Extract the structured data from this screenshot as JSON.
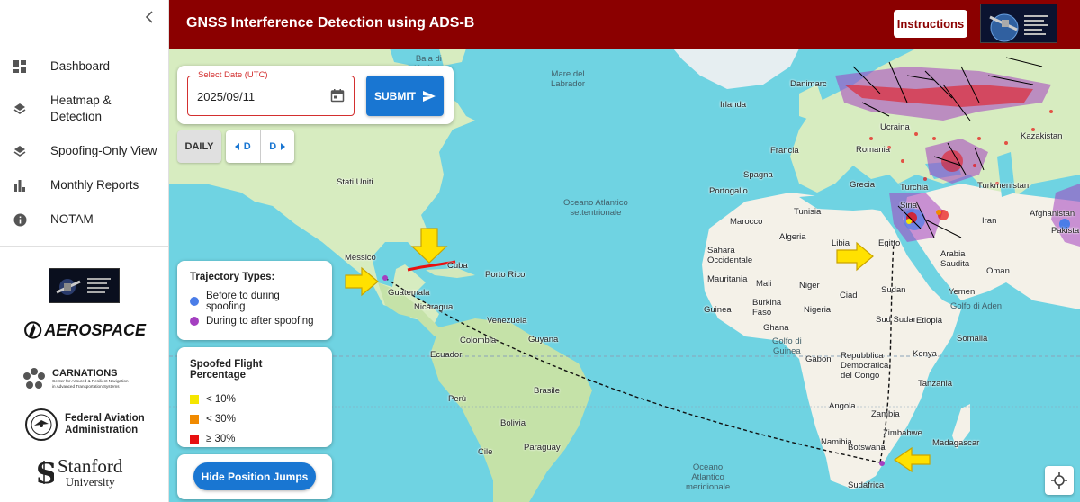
{
  "header": {
    "title": "GNSS Interference Detection using ADS-B",
    "instructions_label": "Instructions"
  },
  "sidebar": {
    "items": [
      {
        "label": "Dashboard",
        "icon": "dashboard-icon"
      },
      {
        "label": "Heatmap & Detection",
        "icon": "layers-icon"
      },
      {
        "label": "Spoofing-Only View",
        "icon": "layers-icon"
      },
      {
        "label": "Monthly Reports",
        "icon": "bar-chart-icon"
      },
      {
        "label": "NOTAM",
        "icon": "info-icon"
      }
    ],
    "logos": {
      "aerospace": "AEROSPACE",
      "carnations_title": "CARNATIONS",
      "carnations_sub1": "Center for Assured & Resilient Navigation",
      "carnations_sub2": "in Advanced Transportation Systems",
      "faa_line1": "Federal Aviation",
      "faa_line2": "Administration",
      "stanford_line1": "Stanford",
      "stanford_line2": "University"
    }
  },
  "date_picker": {
    "label": "Select Date (UTC)",
    "value": "2025/09/11",
    "submit_label": "SUBMIT"
  },
  "controls": {
    "daily_label": "DAILY",
    "prev_label": "D",
    "next_label": "D"
  },
  "trajectory_legend": {
    "title": "Trajectory Types:",
    "items": [
      {
        "label": "Before to during spoofing",
        "color": "#4a7de8"
      },
      {
        "label": "During to after spoofing",
        "color": "#a43fc0"
      }
    ]
  },
  "spoof_legend": {
    "title": "Spoofed Flight Percentage",
    "items": [
      {
        "label": "< 10%",
        "color": "#f5e600"
      },
      {
        "label": "< 30%",
        "color": "#f08a00"
      },
      {
        "label": "≥ 30%",
        "color": "#e81010"
      }
    ]
  },
  "hide_jumps_label": "Hide Position Jumps",
  "map": {
    "labels": {
      "baia": "Baia di\nHudson",
      "mare_labrador": "Mare del\nLabrador",
      "irlanda": "Irlanda",
      "danimarca": "Danimarc",
      "ucraina": "Ucraina",
      "kazakistan": "Kazakistan",
      "romania": "Romania",
      "francia": "Francia",
      "spagna": "Spagna",
      "portogallo": "Portogallo",
      "grecia": "Grecia",
      "turchia": "Turchia",
      "turkmenistan": "Turkmenistan",
      "afghanistan": "Afghanistan",
      "stati_uniti": "Stati Uniti",
      "oceano_atl_sett": "Oceano Atlantico\nsettentrionale",
      "siria": "Siria",
      "iran": "Iran",
      "tunisia": "Tunisia",
      "marocco": "Marocco",
      "pakistan": "Pakista",
      "algeria": "Algeria",
      "libia": "Libia",
      "egitto": "Egitto",
      "messico": "Messico",
      "cuba": "Cuba",
      "portorico": "Porto Rico",
      "sahara_occ": "Sahara\nOccidentale",
      "arabia": "Arabia\nSaudita",
      "oman": "Oman",
      "guatemala": "Guatemala",
      "mauritania": "Mauritania",
      "mali": "Mali",
      "niger": "Niger",
      "ciad": "Ciad",
      "sudan": "Sudan",
      "yemen": "Yemen",
      "nicaragua": "Nicaragua",
      "burkina": "Burkina\nFaso",
      "nigeria": "Nigeria",
      "golfo_aden": "Golfo di Aden",
      "venezuela": "Venezuela",
      "guinea": "Guinea",
      "sud_sudan": "Sud Sudan",
      "etiopia": "Etiopia",
      "colombia": "Colombia",
      "guyana": "Guyana",
      "ghana": "Ghana",
      "golfo_guinea": "Golfo di\nGuinea",
      "somalia": "Somalia",
      "gabon": "Gabon",
      "rdc": "Repubblica\nDemocratica\ndel Congo",
      "kenya": "Kenya",
      "ecuador": "Ecuador",
      "peru": "Perù",
      "brasile": "Brasile",
      "tanzania": "Tanzania",
      "angola": "Angola",
      "bolivia": "Bolivia",
      "zambia": "Zambia",
      "zimbabwe": "Zimbabwe",
      "madagascar": "Madagascar",
      "namibia": "Namibia",
      "botswana": "Botswana",
      "cile": "Cile",
      "paraguay": "Paraguay",
      "oceano_atl_mer": "Oceano\nAtlantico\nmeridionale",
      "sudafrica": "Sudafrica"
    }
  }
}
